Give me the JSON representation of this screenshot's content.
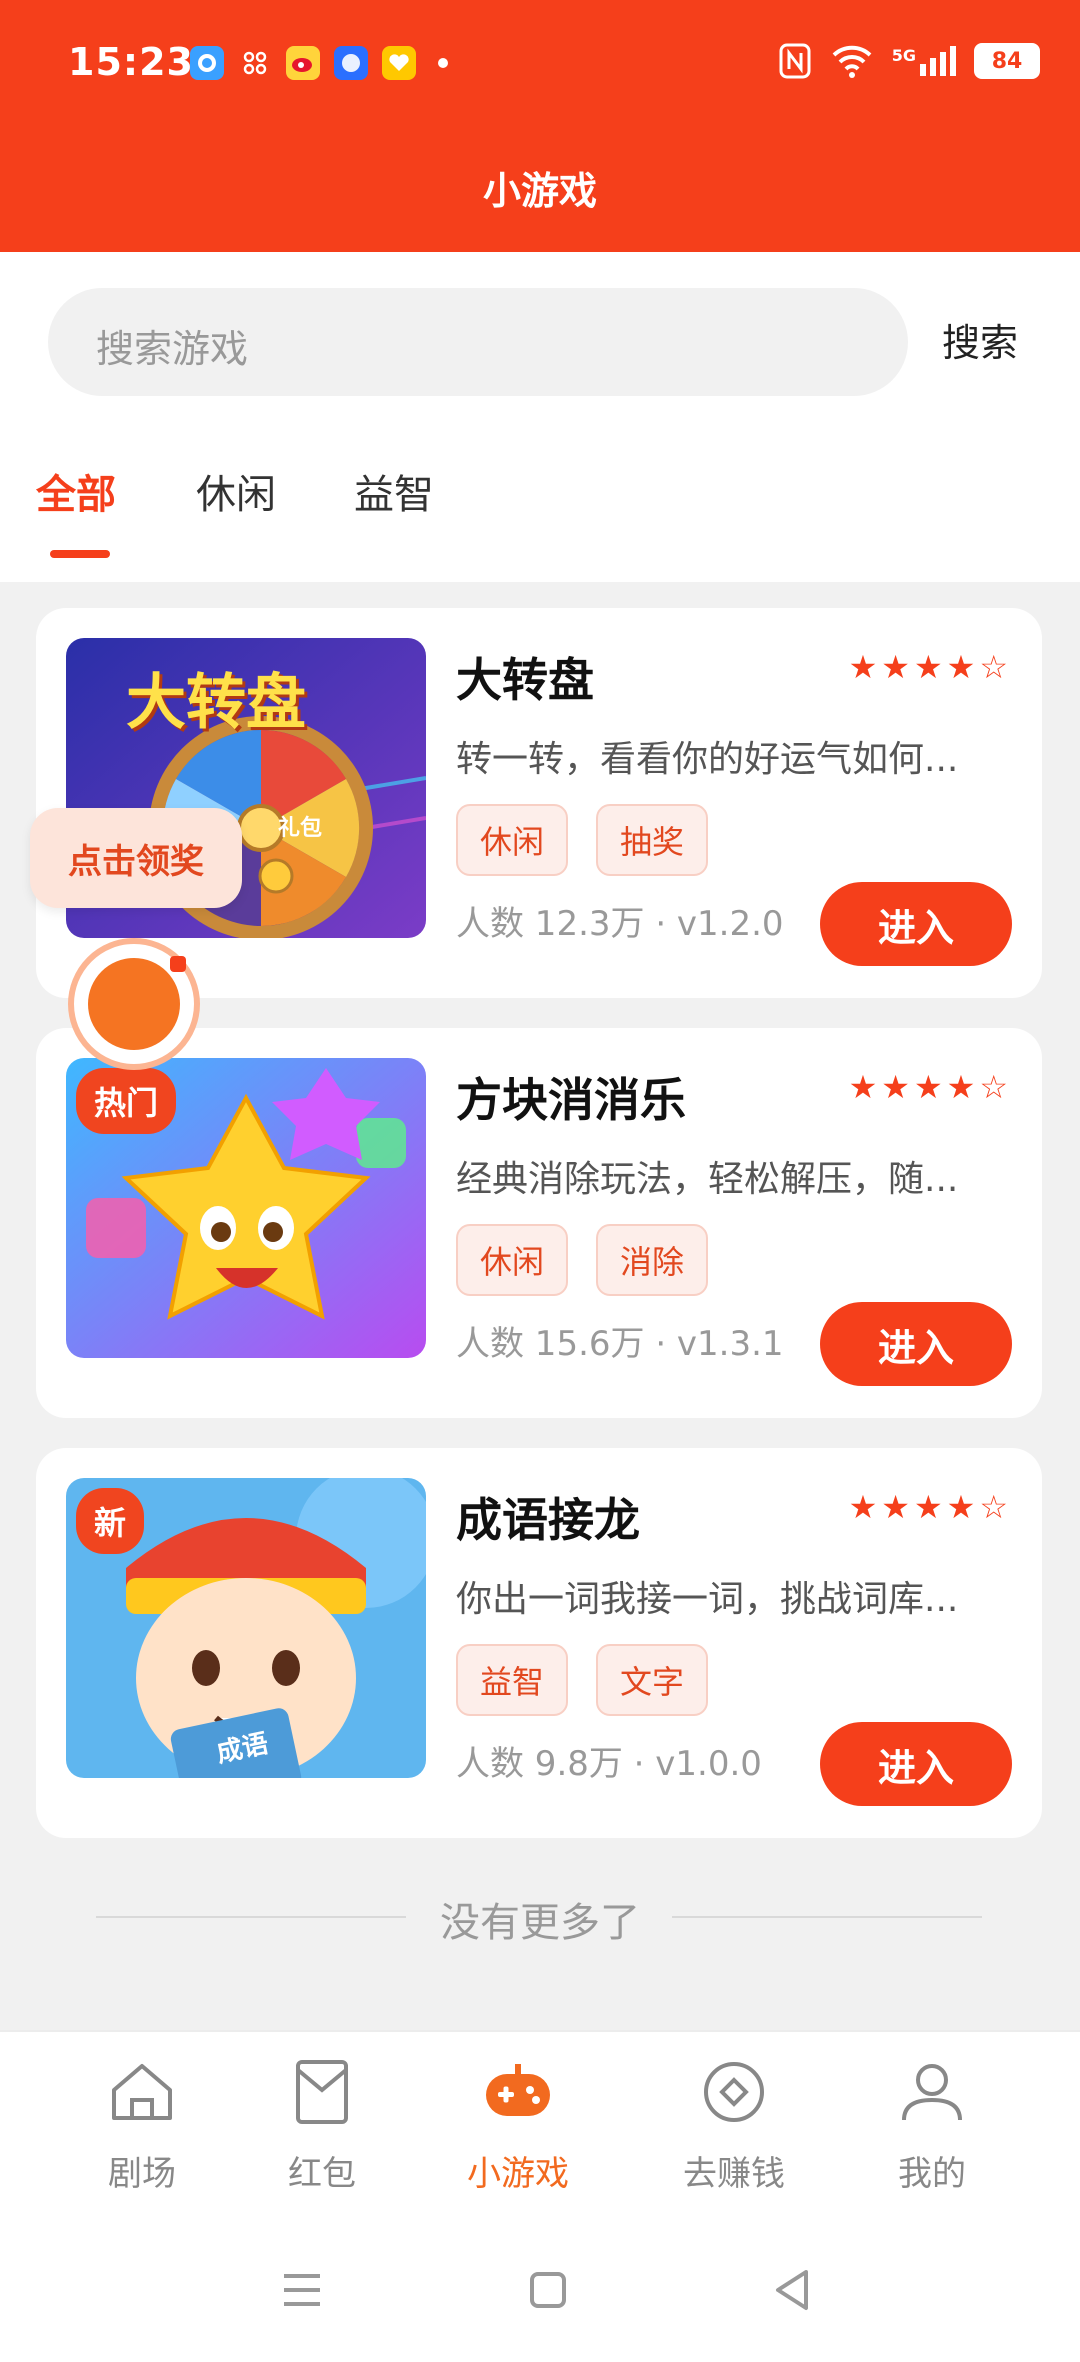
{
  "status_bar": {
    "time": "15:23",
    "battery": "84",
    "network": "5G"
  },
  "header": {
    "title": "小游戏"
  },
  "search": {
    "placeholder": "搜索游戏",
    "button_label": "搜索"
  },
  "tabs": [
    {
      "label": "全部",
      "active": true
    },
    {
      "label": "休闲",
      "active": false
    },
    {
      "label": "益智",
      "active": false
    }
  ],
  "games": [
    {
      "name": "大转盘",
      "rating": "★★★★☆",
      "description": "转一转，看看你的好运气如何...",
      "tags": [
        "休闲",
        "抽奖"
      ],
      "meta": "人数 12.3万 · v1.2.0",
      "enter_label": "进入",
      "thumb_title": "大转盘",
      "wheel_label": "礼包"
    },
    {
      "name": "方块消消乐",
      "rating": "★★★★☆",
      "description": "经典消除玩法，轻松解压，随...",
      "tags": [
        "休闲",
        "消除"
      ],
      "meta": "人数 15.6万 · v1.3.1",
      "enter_label": "进入",
      "badge": "热门"
    },
    {
      "name": "成语接龙",
      "rating": "★★★★☆",
      "description": "你出一词我接一词，挑战词库...",
      "tags": [
        "益智",
        "文字"
      ],
      "meta": "人数 9.8万 · v1.0.0",
      "enter_label": "进入",
      "badge": "新",
      "card_label": "成语"
    }
  ],
  "floating": {
    "claim_label": "点击领奖"
  },
  "list_end": "没有更多了",
  "bottom_nav": [
    {
      "label": "剧场",
      "icon": "home-icon",
      "active": false
    },
    {
      "label": "红包",
      "icon": "red-envelope-icon",
      "active": false
    },
    {
      "label": "小游戏",
      "icon": "gamepad-icon",
      "active": true
    },
    {
      "label": "去赚钱",
      "icon": "coin-icon",
      "active": false
    },
    {
      "label": "我的",
      "icon": "profile-icon",
      "active": false
    }
  ],
  "colors": {
    "brand": "#f53f1b",
    "nav_active": "#f26a1f",
    "tag_bg": "#fdeeea"
  }
}
